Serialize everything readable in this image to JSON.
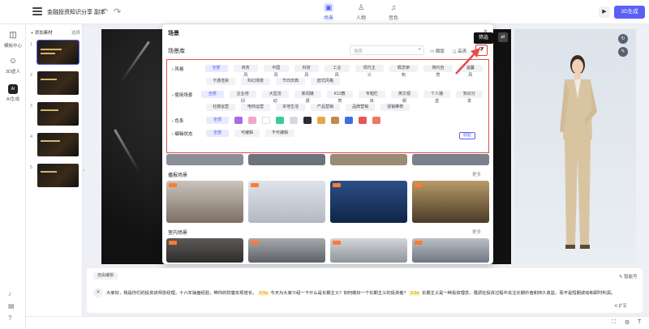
{
  "topbar": {
    "doc_title": "金融投资知识分享 副本",
    "tabs": [
      {
        "label": "场景",
        "icon": "scene-icon",
        "active": true
      },
      {
        "label": "人物",
        "icon": "person-icon",
        "active": false
      },
      {
        "label": "音色",
        "icon": "voice-icon",
        "active": false
      }
    ],
    "generate_label": "3D生成"
  },
  "rail": {
    "items": [
      {
        "label": "模板中心",
        "icon": "template-icon"
      },
      {
        "label": "3D虚人",
        "icon": "avatar-icon"
      },
      {
        "label": "AI生成",
        "icon_text": "AI"
      }
    ]
  },
  "slides": {
    "add_label": "+ 添加素材",
    "select_label": "选择",
    "numbers": [
      "1",
      "2",
      "3",
      "4",
      "5"
    ]
  },
  "dialog": {
    "title": "场景",
    "library_title": "场景库",
    "search_placeholder": "搜索",
    "opt_landscape": "横版",
    "opt_hd": "高清",
    "tooltip": "筛选",
    "filters": {
      "style": {
        "label": "风格",
        "chips": [
          "全部",
          "商务风",
          "中国风",
          "科技风",
          "工业风",
          "现代主义",
          "概念架构",
          "简约自然",
          "温馨风",
          "卡通渲染",
          "科幻场景",
          "节日庆典",
          "欧式风格"
        ]
      },
      "scene": {
        "label": "使用场景",
        "chips": [
          "全部",
          "企业培训",
          "大型活动",
          "新闻播报",
          "K12教育",
          "专题栏目",
          "英文视频",
          "个人播送",
          "知识分享",
          "社媒运营",
          "电商运营",
          "本地生活",
          "产品营销",
          "品牌营销",
          "促销推荐"
        ]
      },
      "color": {
        "label": "色系",
        "chips": [
          "全部"
        ],
        "swatches": [
          "#a86be8",
          "#f3a6c8",
          "#ffffff",
          "#3ec9a0",
          "#d8d8e0",
          "#2b2b33",
          "#e7a649",
          "#c3884f",
          "#3d6fe0",
          "#e85656",
          "#ea7a60"
        ]
      },
      "edit": {
        "label": "编辑状态",
        "chips": [
          "全部",
          "可编辑",
          "不可编辑"
        ]
      }
    },
    "fold_label": "收起",
    "sections": [
      {
        "title": "播报场景",
        "more": "更多"
      },
      {
        "title": "室内场景",
        "more": "更多"
      }
    ]
  },
  "script": {
    "tag": "自由编辑",
    "voice": "智能写",
    "segments": [
      {
        "text": "大家好，我是你们的投资讲师张经理，十六年操盘经验，带你的财富实现增长。",
        "pause": false
      },
      {
        "text": "0.5s",
        "pause": true
      },
      {
        "text": "今天为大家介绍一下什么是长期主义？如何做好一个长期主义的投资者？",
        "pause": false
      },
      {
        "text": "0.5s",
        "pause": true
      },
      {
        "text": "长期主义是一种投资理念，强调在投资过程中关注长期价值和持久收益，而不是短期波动和即时利润。",
        "pause": false
      }
    ],
    "extend_label": "扩写"
  },
  "colors": {
    "accent": "#5b5ff6",
    "highlight": "#e34d4d"
  }
}
